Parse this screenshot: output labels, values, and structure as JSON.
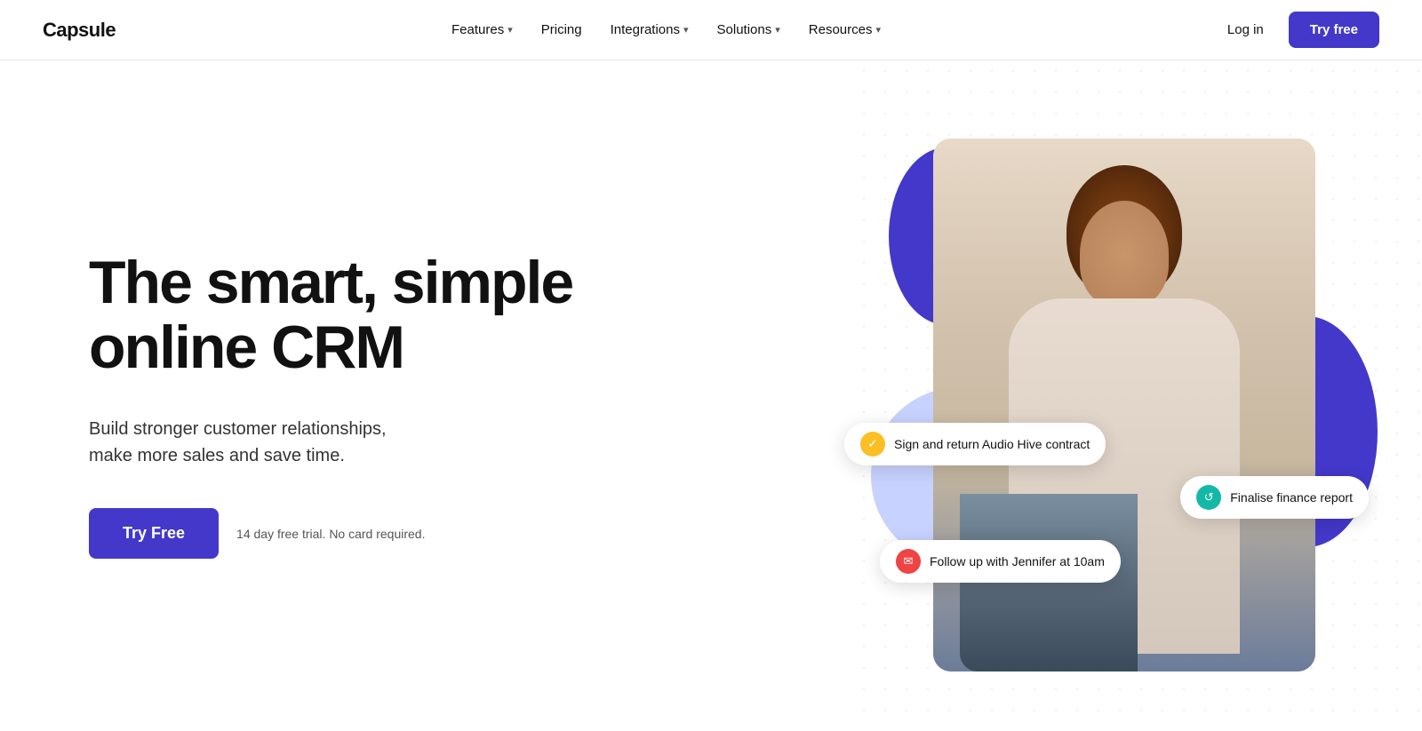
{
  "brand": {
    "logo": "Capsule"
  },
  "nav": {
    "links": [
      {
        "label": "Features",
        "has_dropdown": true
      },
      {
        "label": "Pricing",
        "has_dropdown": false
      },
      {
        "label": "Integrations",
        "has_dropdown": true
      },
      {
        "label": "Solutions",
        "has_dropdown": true
      },
      {
        "label": "Resources",
        "has_dropdown": true
      }
    ],
    "login_label": "Log in",
    "try_btn_label": "Try free"
  },
  "hero": {
    "heading_line1": "The smart, simple",
    "heading_line2": "online CRM",
    "subtext_line1": "Build stronger customer relationships,",
    "subtext_line2": "make more sales and save time.",
    "cta_btn_label": "Try Free",
    "trial_text": "14 day free trial. No card required."
  },
  "toasts": [
    {
      "icon_type": "yellow",
      "icon_symbol": "✓",
      "text": "Sign and return Audio Hive contract"
    },
    {
      "icon_type": "teal",
      "icon_symbol": "↺",
      "text": "Finalise finance report"
    },
    {
      "icon_type": "red",
      "icon_symbol": "✉",
      "text": "Follow up with Jennifer at 10am"
    }
  ],
  "colors": {
    "brand_purple": "#4338ca",
    "accent_lavender": "#c7d2fe"
  }
}
